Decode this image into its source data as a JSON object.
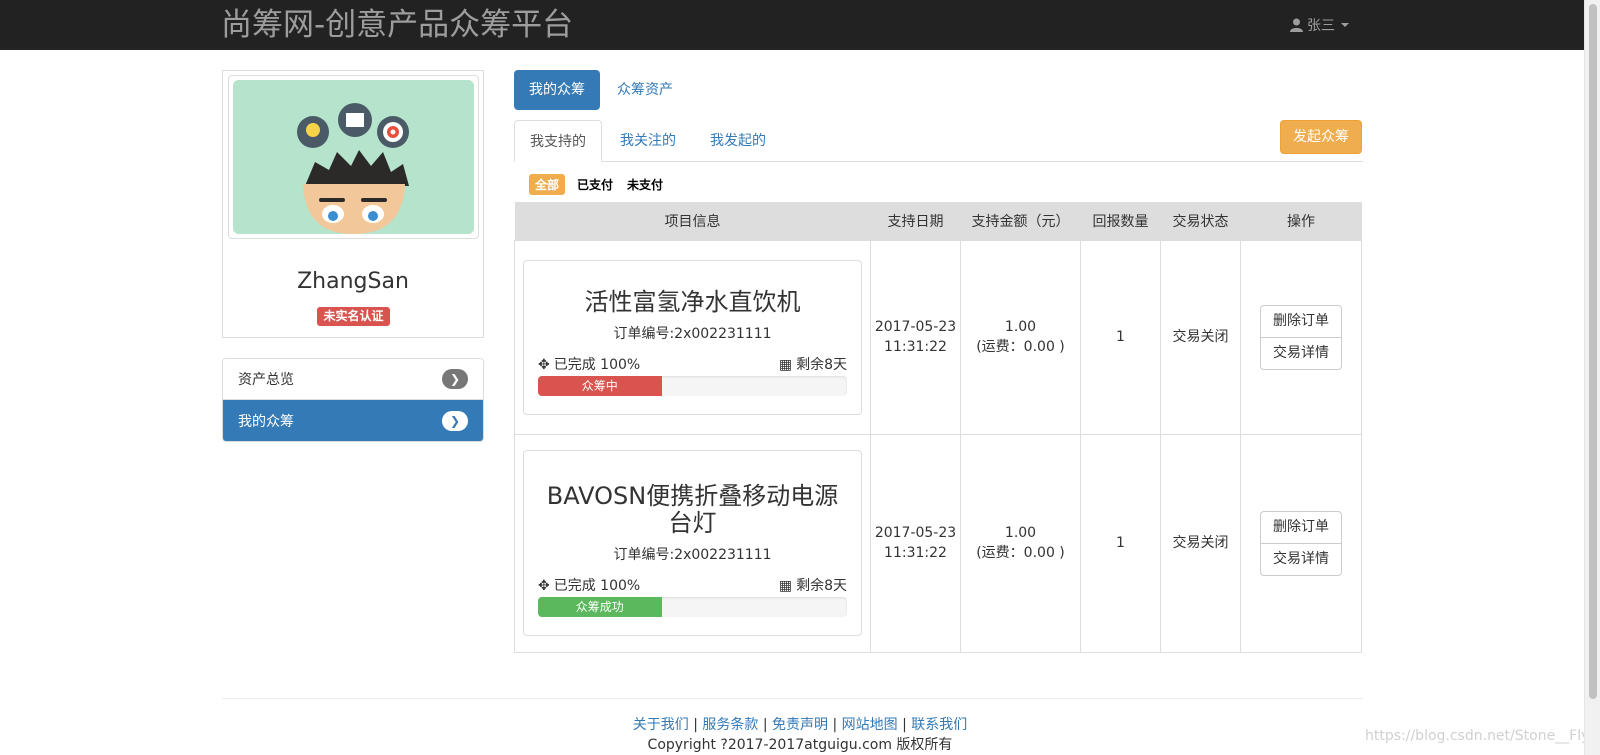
{
  "header": {
    "brand": "尚筹网-创意产品众筹平台",
    "user_name": "张三"
  },
  "profile": {
    "name": "ZhangSan",
    "badge": "未实名认证"
  },
  "side_menu": {
    "items": [
      {
        "label": "资产总览",
        "active": false
      },
      {
        "label": "我的众筹",
        "active": true
      }
    ]
  },
  "main_tabs": {
    "my_crowdfunding": "我的众筹",
    "assets": "众筹资产"
  },
  "sub_tabs": {
    "supported": "我支持的",
    "followed": "我关注的",
    "launched": "我发起的"
  },
  "launch_button": "发起众筹",
  "filters": {
    "all": "全部",
    "paid": "已支付",
    "unpaid": "未支付"
  },
  "table": {
    "headers": {
      "info": "项目信息",
      "date": "支持日期",
      "amount": "支持金额（元）",
      "quantity": "回报数量",
      "status": "交易状态",
      "actions": "操作"
    },
    "rows": [
      {
        "title": "活性富氢净水直饮机",
        "order_no": "订单编号:2x002231111",
        "completed": "已完成 100%",
        "remaining": "剩余8天",
        "bar_label": "众筹中",
        "bar_color": "#d9534f",
        "bar_fraction": 0.4,
        "date": "2017-05-23",
        "time": "11:31:22",
        "amount": "1.00",
        "shipping": "(运费：0.00 )",
        "quantity": "1",
        "status": "交易关闭",
        "delete_label": "删除订单",
        "detail_label": "交易详情"
      },
      {
        "title": "BAVOSN便携折叠移动电源台灯",
        "order_no": "订单编号:2x002231111",
        "completed": "已完成 100%",
        "remaining": "剩余8天",
        "bar_label": "众筹成功",
        "bar_color": "#5cb85c",
        "bar_fraction": 0.4,
        "date": "2017-05-23",
        "time": "11:31:22",
        "amount": "1.00",
        "shipping": "(运费：0.00 )",
        "quantity": "1",
        "status": "交易关闭",
        "delete_label": "删除订单",
        "detail_label": "交易详情"
      }
    ]
  },
  "footer": {
    "links": [
      "关于我们",
      "服务条款",
      "免责声明",
      "网站地图",
      "联系我们"
    ],
    "copyright": "Copyright ?2017-2017atguigu.com 版权所有"
  },
  "watermark": "https://blog.csdn.net/Stone__Fly",
  "colors": {
    "navbar": "#222222",
    "primary": "#337ab7",
    "warning": "#f0ad4e",
    "danger": "#d9534f",
    "success": "#5cb85c"
  }
}
